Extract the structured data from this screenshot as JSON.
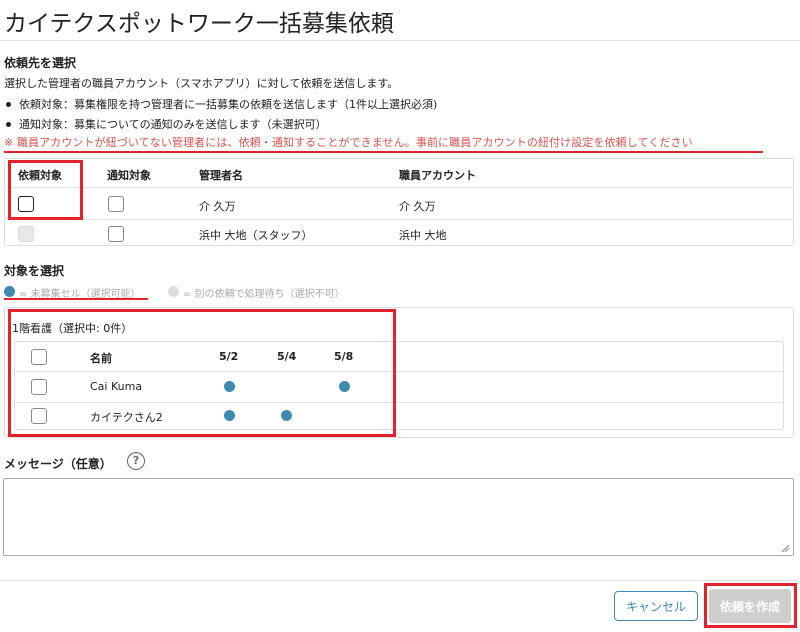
{
  "page": {
    "title": "カイテクスポットワーク一括募集依頼"
  },
  "recipient_section": {
    "heading": "依頼先を選択",
    "description": "選択した管理者の職員アカウント（スマホアプリ）に対して依頼を送信します。",
    "bullets": [
      "依頼対象：募集権限を持つ管理者に一括募集の依頼を送信します（1件以上選択必須)",
      "通知対象：募集についての通知のみを送信します（未選択可）"
    ],
    "warning": "※ 職員アカウントが紐づいてない管理者には、依頼・通知することができません。事前に職員アカウントの紐付け設定を依頼してください",
    "table": {
      "headers": {
        "request": "依頼対象",
        "notify": "通知対象",
        "manager": "管理者名",
        "account": "職員アカウント"
      },
      "rows": [
        {
          "manager": "介 久万",
          "account": "介 久万"
        },
        {
          "manager": "浜中 大地（スタッフ）",
          "account": "浜中 大地"
        }
      ]
    }
  },
  "target_section": {
    "heading": "対象を選択",
    "legend_open": "= 未募集セル（選択可能）",
    "legend_pending": "= 別の依頼で処理待ち（選択不可）",
    "open_color": "#3d8bb0",
    "pending_color": "#dddddd",
    "panel": {
      "title": "1階看護（選択中: 0件）",
      "name_header": "名前",
      "dates": [
        "5/2",
        "5/4",
        "5/8"
      ],
      "rows": [
        {
          "name": "Cai Kuma",
          "slots": [
            true,
            false,
            true
          ]
        },
        {
          "name": "カイテクさん2",
          "slots": [
            true,
            true,
            false
          ]
        }
      ]
    }
  },
  "message_section": {
    "heading": "メッセージ（任意）",
    "help_glyph": "?",
    "value": ""
  },
  "footer": {
    "cancel_label": "キャンセル",
    "create_label": "依頼を作成"
  },
  "colors": {
    "accent": "#3d8bb0",
    "warning": "#d9534f",
    "highlight": "#e3232b"
  }
}
